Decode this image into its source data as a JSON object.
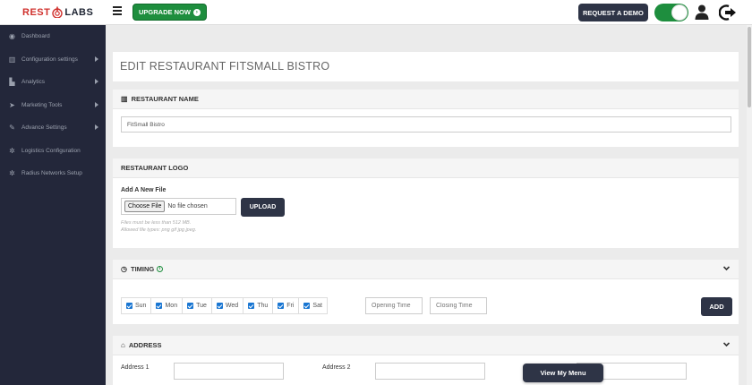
{
  "brand": {
    "left": "REST",
    "right": "LABS"
  },
  "topbar": {
    "upgrade_label": "UPGRADE NOW",
    "demo_label": "REQUEST A DEMO"
  },
  "sidebar": {
    "items": [
      {
        "label": "Dashboard",
        "icon": "dashboard-icon",
        "has_arrow": false
      },
      {
        "label": "Configuration settings",
        "icon": "bank-icon",
        "has_arrow": true
      },
      {
        "label": "Analytics",
        "icon": "chart-icon",
        "has_arrow": true
      },
      {
        "label": "Marketing Tools",
        "icon": "send-icon",
        "has_arrow": true
      },
      {
        "label": "Advance Settings",
        "icon": "wrench-icon",
        "has_arrow": true
      },
      {
        "label": "Logistics Configuration",
        "icon": "gear-icon",
        "has_arrow": false
      },
      {
        "label": "Radius Networks Setup",
        "icon": "gear-icon",
        "has_arrow": false
      }
    ]
  },
  "page": {
    "title": "EDIT RESTAURANT FITSMALL BISTRO"
  },
  "restaurant_name": {
    "heading": "RESTAURANT NAME",
    "value": "FitSmall Bistro"
  },
  "restaurant_logo": {
    "heading": "RESTAURANT LOGO",
    "new_file_label": "Add A New File",
    "choose_label": "Choose File",
    "no_file_text": "No file chosen",
    "upload_label": "UPLOAD",
    "hint_size": "Files must be less than 512 MB.",
    "hint_types": "Allowed file types: png gif jpg jpeg."
  },
  "timing": {
    "heading": "TIMING",
    "days": [
      "Sun",
      "Mon",
      "Tue",
      "Wed",
      "Thu",
      "Fri",
      "Sat"
    ],
    "opening_placeholder": "Opening Time",
    "closing_placeholder": "Closing Time",
    "add_label": "ADD"
  },
  "address": {
    "heading": "ADDRESS",
    "address1_label": "Address 1",
    "address2_label": "Address 2"
  },
  "view_menu_label": "View My Menu",
  "colors": {
    "sidebar": "#23273a",
    "accent_green": "#1e8e3e",
    "dark_button": "#2e3446"
  }
}
